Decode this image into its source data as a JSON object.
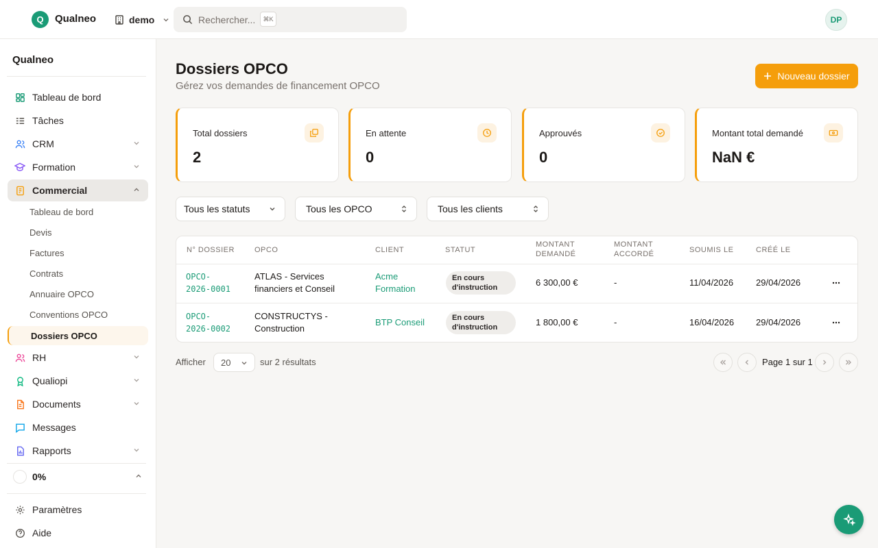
{
  "topbar": {
    "logo_letter": "Q",
    "app_name": "Qualneo",
    "workspace": "demo",
    "search_placeholder": "Rechercher...",
    "shortcut": "⌘K",
    "avatar_initials": "DP"
  },
  "sidebar": {
    "org_name": "Qualneo",
    "items": [
      {
        "label": "Tableau de bord",
        "icon": "dashboard-icon"
      },
      {
        "label": "Tâches",
        "icon": "tasks-icon"
      },
      {
        "label": "CRM",
        "icon": "users-icon"
      },
      {
        "label": "Formation",
        "icon": "graduation-cap-icon"
      },
      {
        "label": "Commercial",
        "icon": "commercial-icon"
      },
      {
        "label": "RH",
        "icon": "team-icon"
      },
      {
        "label": "Qualiopi",
        "icon": "award-icon"
      },
      {
        "label": "Documents",
        "icon": "document-icon"
      },
      {
        "label": "Messages",
        "icon": "message-icon"
      },
      {
        "label": "Rapports",
        "icon": "report-icon"
      }
    ],
    "commercial_sub": [
      "Tableau de bord",
      "Devis",
      "Factures",
      "Contrats",
      "Annuaire OPCO",
      "Conventions OPCO",
      "Dossiers OPCO"
    ],
    "progress": "0%",
    "footer": [
      {
        "label": "Paramètres",
        "icon": "gear-icon"
      },
      {
        "label": "Aide",
        "icon": "help-icon"
      }
    ]
  },
  "main": {
    "title": "Dossiers OPCO",
    "subtitle": "Gérez vos demandes de financement OPCO",
    "new_button": "Nouveau dossier",
    "stats": [
      {
        "label": "Total dossiers",
        "value": "2",
        "icon": "copy-icon"
      },
      {
        "label": "En attente",
        "value": "0",
        "icon": "clock-icon"
      },
      {
        "label": "Approuvés",
        "value": "0",
        "icon": "check-circle-icon"
      },
      {
        "label": "Montant total demandé",
        "value": "NaN €",
        "icon": "banknote-icon"
      }
    ],
    "filters": [
      "Tous les statuts",
      "Tous les OPCO",
      "Tous les clients"
    ],
    "table": {
      "headers": [
        "N° DOSSIER",
        "OPCO",
        "CLIENT",
        "STATUT",
        "MONTANT",
        "DEMANDÉ",
        "MONTANT",
        "ACCORDÉ",
        "SOUMIS LE",
        "CRÉÉ LE"
      ],
      "rows": [
        {
          "num1": "OPCO-",
          "num2": "2026-0001",
          "opco1": "ATLAS - Services",
          "opco2": "financiers et Conseil",
          "client1": "Acme",
          "client2": "Formation",
          "status1": "En cours",
          "status2": "d'instruction",
          "requested": "6 300,00 €",
          "granted": "-",
          "submitted": "11/04/2026",
          "created": "29/04/2026"
        },
        {
          "num1": "OPCO-",
          "num2": "2026-0002",
          "opco1": "CONSTRUCTYS -",
          "opco2": "Construction",
          "client1": "BTP Conseil",
          "client2": "",
          "status1": "En cours",
          "status2": "d'instruction",
          "requested": "1 800,00 €",
          "granted": "-",
          "submitted": "16/04/2026",
          "created": "29/04/2026"
        }
      ]
    },
    "pagination": {
      "show_label": "Afficher",
      "page_size": "20",
      "results": "sur 2 résultats",
      "page_info": "Page 1 sur 1"
    }
  },
  "colors": {
    "accent": "#f59e0b",
    "brand": "#1a9b76"
  }
}
